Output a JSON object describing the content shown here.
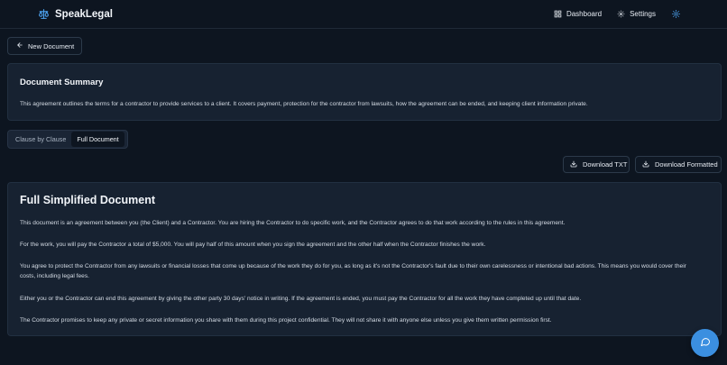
{
  "header": {
    "app_name": "SpeakLegal",
    "nav": [
      {
        "label": "Dashboard",
        "icon": "grid-icon"
      },
      {
        "label": "Settings",
        "icon": "gear-icon"
      }
    ],
    "theme_icon": "sun-icon"
  },
  "back_button": {
    "label": "New Document",
    "icon": "arrow-left-icon"
  },
  "summary": {
    "title": "Document Summary",
    "body": "This agreement outlines the terms for a contractor to provide services to a client. It covers payment, protection for the contractor from lawsuits, how the agreement can be ended, and keeping client information private."
  },
  "view_toggle": {
    "options": [
      "Clause by Clause",
      "Full Document"
    ],
    "selected": "Full Document"
  },
  "downloads": {
    "txt_label": "Download TXT",
    "formatted_label": "Download Formatted",
    "icon": "download-icon"
  },
  "document": {
    "title": "Full Simplified Document",
    "paragraphs": [
      "This document is an agreement between you (the Client) and a Contractor. You are hiring the Contractor to do specific work, and the Contractor agrees to do that work according to the rules in this agreement.",
      "For the work, you will pay the Contractor a total of $5,000. You will pay half of this amount when you sign the agreement and the other half when the Contractor finishes the work.",
      "You agree to protect the Contractor from any lawsuits or financial losses that come up because of the work they do for you, as long as it's not the Contractor's fault due to their own carelessness or intentional bad actions. This means you would cover their costs, including legal fees.",
      "Either you or the Contractor can end this agreement by giving the other party 30 days' notice in writing. If the agreement is ended, you must pay the Contractor for all the work they have completed up until that date.",
      "The Contractor promises to keep any private or secret information you share with them during this project confidential. They will not share it with anyone else unless you give them written permission first."
    ]
  },
  "chat_button": {
    "icon": "chat-bubble-icon"
  },
  "colors": {
    "accent": "#3b8fe0",
    "background": "#0d1520",
    "card": "#172231"
  }
}
